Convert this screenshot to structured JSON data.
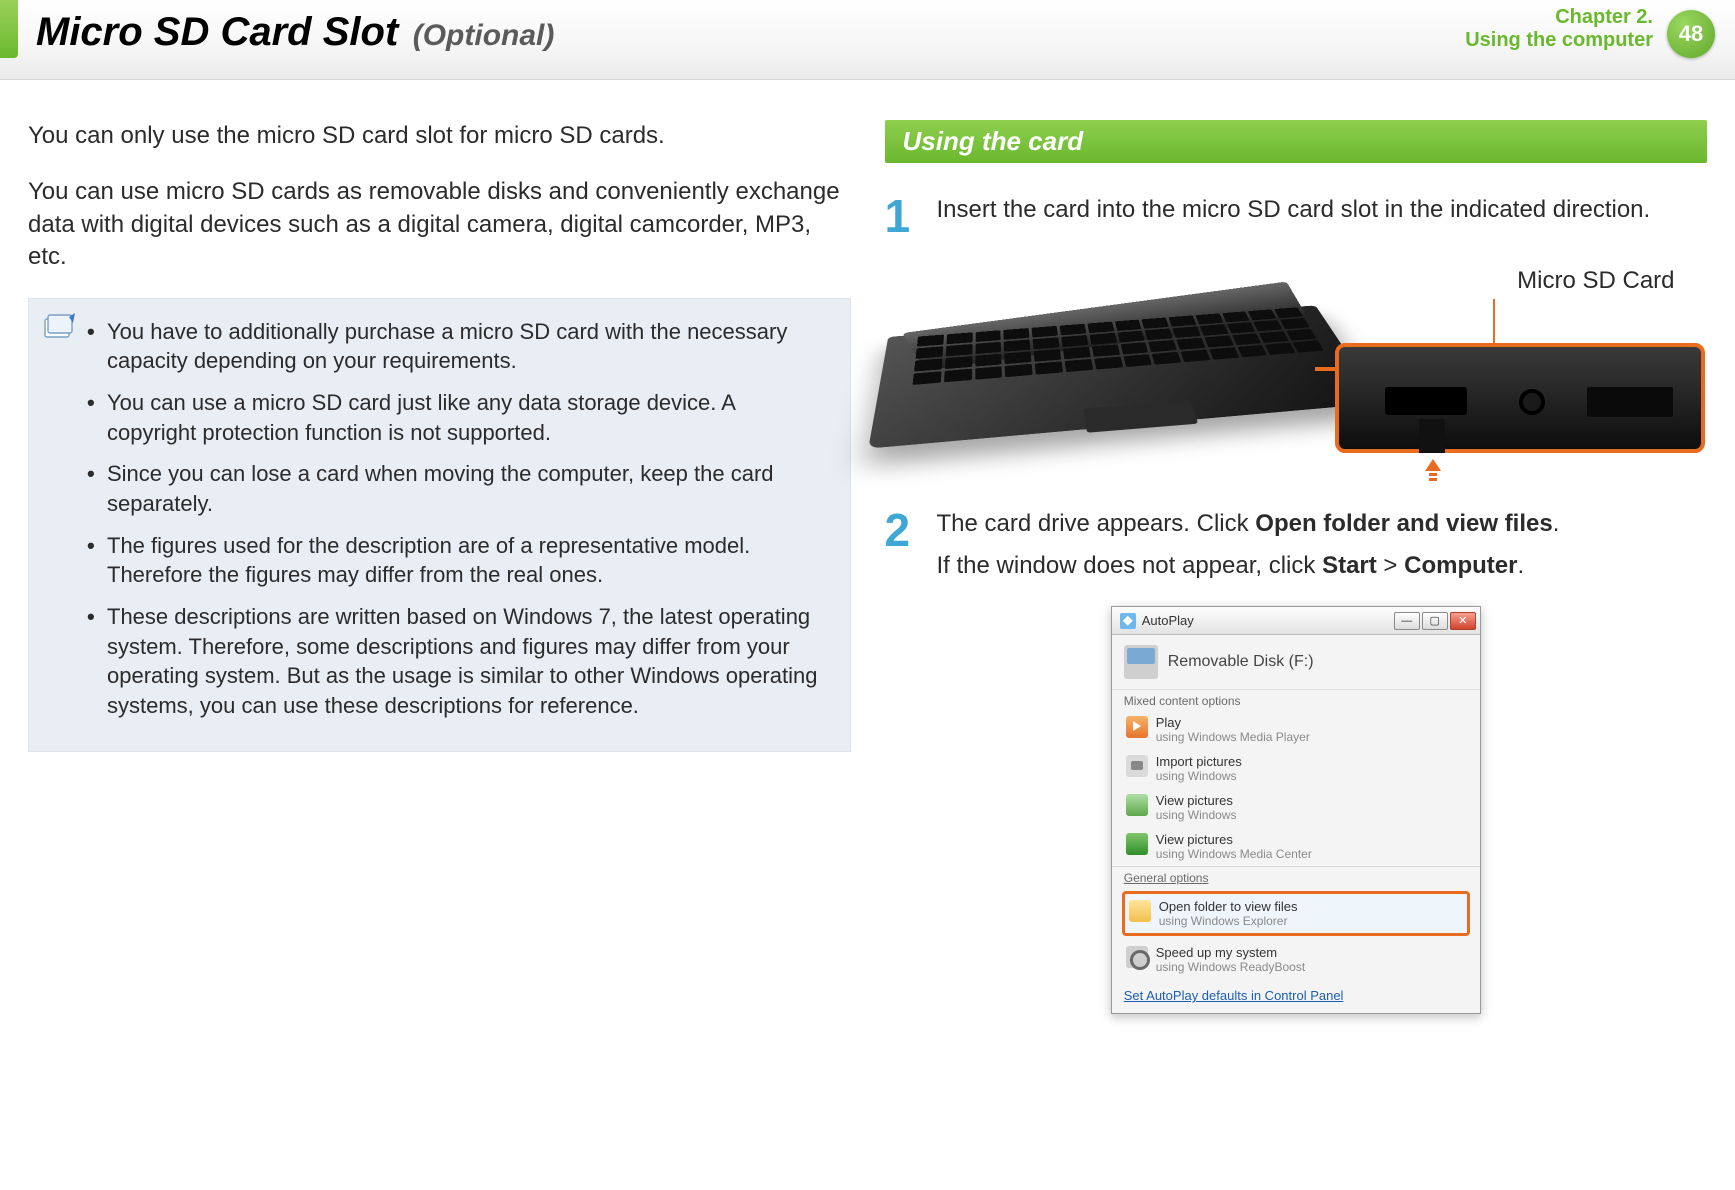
{
  "header": {
    "title": "Micro SD Card Slot",
    "subtitle": "(Optional)",
    "chapter_line1": "Chapter 2.",
    "chapter_line2": "Using the computer",
    "page_number": "48"
  },
  "left": {
    "para1": "You can only use the micro SD card slot for micro SD cards.",
    "para2": "You can use micro SD cards as removable disks and conveniently exchange data with digital devices such as a digital camera, digital camcorder, MP3, etc.",
    "notes": [
      "You have to additionally purchase a micro SD card with the necessary capacity depending on your requirements.",
      "You can use a micro SD card just like any data storage device.\nA copyright protection function is not supported.",
      "Since you can lose a card when moving the computer, keep the card separately.",
      "The figures used for the description are of a representative model. Therefore the figures may differ from the real ones.",
      "These descriptions are written based on Windows 7, the latest operating system. Therefore, some descriptions and figures may differ from your operating system. But as the usage is similar to other Windows operating systems, you can use these descriptions for reference."
    ]
  },
  "right": {
    "section_title": "Using the card",
    "step1": {
      "num": "1",
      "text": "Insert the card into the micro SD card slot in the indicated direction."
    },
    "figure": {
      "sd_label": "Micro SD Card"
    },
    "step2": {
      "num": "2",
      "line1_pre": "The card drive appears. Click ",
      "line1_bold": "Open folder and view files",
      "line1_post": ".",
      "line2_pre": "If the window does not appear, click ",
      "line2_bold1": "Start",
      "line2_mid": " > ",
      "line2_bold2": "Computer",
      "line2_post": "."
    },
    "autoplay": {
      "title": "AutoPlay",
      "drive": "Removable Disk (F:)",
      "group_mixed": "Mixed content options",
      "items": [
        {
          "l1": "Play",
          "l2": "using Windows Media Player"
        },
        {
          "l1": "Import pictures",
          "l2": "using Windows"
        },
        {
          "l1": "View pictures",
          "l2": "using Windows"
        },
        {
          "l1": "View pictures",
          "l2": "using Windows Media Center"
        }
      ],
      "group_general": "General options",
      "highlight": {
        "l1": "Open folder to view files",
        "l2": "using Windows Explorer"
      },
      "boost": {
        "l1": "Speed up my system",
        "l2": "using Windows ReadyBoost"
      },
      "footer_link": "Set AutoPlay defaults in Control Panel"
    }
  }
}
